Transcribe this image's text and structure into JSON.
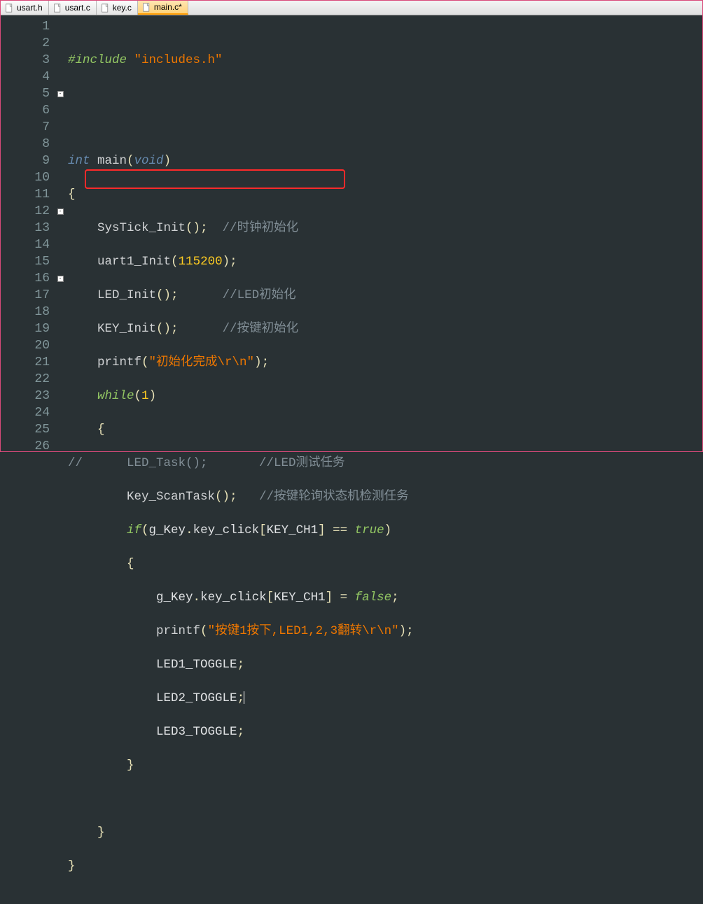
{
  "tabs": [
    {
      "label": "usart.h",
      "active": false
    },
    {
      "label": "usart.c",
      "active": false
    },
    {
      "label": "key.c",
      "active": false
    },
    {
      "label": "main.c*",
      "active": true
    }
  ],
  "line_count": 26,
  "fold_markers": {
    "5": "-",
    "12": "-",
    "16": "-"
  },
  "code": {
    "l1": {
      "inc": "#include ",
      "str": "\"includes.h\""
    },
    "l4": {
      "t_int": "int",
      "main": " main",
      "t_void": "void"
    },
    "l6": {
      "fn": "SysTick_Init",
      "cmt": "//时钟初始化"
    },
    "l7": {
      "fn": "uart1_Init",
      "arg": "115200"
    },
    "l8": {
      "fn": "LED_Init",
      "cmt": "//LED初始化"
    },
    "l9": {
      "fn": "KEY_Init",
      "cmt": "//按键初始化"
    },
    "l10": {
      "fn": "printf",
      "str": "\"初始化完成\\r\\n\""
    },
    "l11": {
      "kw": "while",
      "arg": "1"
    },
    "l13": {
      "cmt": "//      LED_Task();       //LED测试任务"
    },
    "l14": {
      "fn": "Key_ScanTask",
      "cmt": "//按键轮询状态机检测任务"
    },
    "l15": {
      "kw": "if",
      "obj": "g_Key",
      "mem": "key_click",
      "idx": "KEY_CH1",
      "op": " == ",
      "bool": "true"
    },
    "l17": {
      "obj": "g_Key",
      "mem": "key_click",
      "idx": "KEY_CH1",
      "op": " = ",
      "bool": "false"
    },
    "l18": {
      "fn": "printf",
      "str": "\"按键1按下,LED1,2,3翻转\\r\\n\""
    },
    "l19": {
      "id": "LED1_TOGGLE"
    },
    "l20": {
      "id": "LED2_TOGGLE"
    },
    "l21": {
      "id": "LED3_TOGGLE"
    }
  }
}
